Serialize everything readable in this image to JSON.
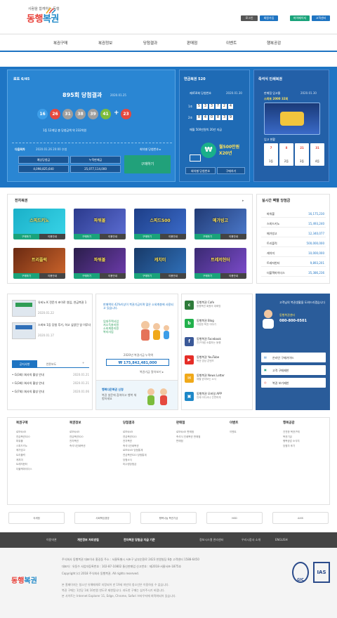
{
  "header": {
    "tagline": "사람을 함께하는 동행",
    "logo_red": "동행",
    "logo_blue": "복권",
    "buttons": [
      "로그인",
      "회원가입",
      "마이페이지",
      "고객센터"
    ]
  },
  "nav": [
    "복권구매",
    "복권정보",
    "당첨결과",
    "판매점",
    "이벤트",
    "행복공감"
  ],
  "lotto": {
    "title": "로또 6/45",
    "round": "895회 당첨결과",
    "date": "2020.01.25",
    "balls": [
      {
        "n": "16",
        "c": "#3d9ee8"
      },
      {
        "n": "26",
        "c": "#e5493e"
      },
      {
        "n": "31",
        "c": "#9e9e9e"
      },
      {
        "n": "38",
        "c": "#9e9e9e"
      },
      {
        "n": "39",
        "c": "#9e9e9e"
      },
      {
        "n": "41",
        "c": "#7cbc3c"
      },
      {
        "n": "23",
        "c": "#e5493e"
      }
    ],
    "summary": "1등 12게임 총 당첨금액 약 232억원",
    "next_label": "다음회차",
    "next_date": "2020.01.26 20:00 추첨",
    "prize_label": "예상당첨금",
    "prize_value": "4,098,825,640",
    "accum_label": "누적판매금",
    "accum_value": "25,077,114,000",
    "prev_link": "회차별 당첨번호 ▸",
    "buy": "구매하기"
  },
  "pension": {
    "title": "연금복권 520",
    "round": "제450회 당첨번호",
    "date": "2020.01.30",
    "row1_label": "1조",
    "row1": [
      "5",
      "3",
      "3",
      "7",
      "2",
      "4"
    ],
    "row2_label": "2조",
    "row2": [
      "8",
      "4",
      "0",
      "8",
      "3",
      "9"
    ],
    "bonus": "매월 500만원씩 20년 지급",
    "promo": "월500만원 X20년",
    "btn1": "회차별 당첨번호",
    "btn2": "구매하기"
  },
  "speetto": {
    "title": "즉석식 인쇄복권",
    "sub": "판매점 입고율",
    "date": "2020.01.30",
    "game": "스피또 2000 32회",
    "card_labels": [
      "1등",
      "2등",
      "3등",
      "4등"
    ],
    "stock_label": "입고 현황",
    "stock_values": [
      "7",
      "8",
      "21",
      "31"
    ]
  },
  "games": {
    "title": "전자복권",
    "list": [
      {
        "name": "스피드키노",
        "bg": "#1ab0c8",
        "a": "#37d2e6"
      },
      {
        "name": "파워볼",
        "bg": "#2b3a8c",
        "a": "#5a6bd0"
      },
      {
        "name": "스피드500",
        "bg": "#1d3e87",
        "a": "#3a6ac8"
      },
      {
        "name": "메가빙고",
        "bg": "#213a74",
        "a": "#4a77c8"
      },
      {
        "name": "트리플럭",
        "bg": "#6a2a12",
        "a": "#c8622a"
      },
      {
        "name": "파워볼",
        "bg": "#2a1e4a",
        "a": "#6a3aa8"
      },
      {
        "name": "캐치미",
        "bg": "#183a68",
        "a": "#2f6fb8"
      },
      {
        "name": "트레저헌터",
        "bg": "#3a2a72",
        "a": "#7a4ac8"
      }
    ],
    "buy": "구매하기",
    "info": "이용안내"
  },
  "ranking": {
    "title": "실시간 팩별 당첨금",
    "rows": [
      {
        "n": "파워볼",
        "v": "16,175,230"
      },
      {
        "n": "스피드키노",
        "v": "15,493,240"
      },
      {
        "n": "메가빙고",
        "v": "12,340,077"
      },
      {
        "n": "트리플럭",
        "v": "500,000,000"
      },
      {
        "n": "캐치미",
        "v": "10,000,000"
      },
      {
        "n": "트레저헌터",
        "v": "9,893,201"
      },
      {
        "n": "더블잭마이더스",
        "v": "35,386,236"
      }
    ]
  },
  "news": {
    "item1_t": "유비노 K 전문가 초이로 영입, 연금복권 1",
    "item1_d": "2020.01.22",
    "item2_t": "스피또 1등 당첨 후기, 하고 싶었던 일 이루다",
    "item2_d": "2020.01.17",
    "tabs": [
      "공지사항",
      "언론보도"
    ],
    "list": [
      {
        "t": "G(3회) 회사의 활성 안내",
        "d": "2020.01.21"
      },
      {
        "t": "G(3회) 회사의 활성 안내",
        "d": "2020.01.21"
      },
      {
        "t": "G(7회) 회사의 활성 안내",
        "d": "2020.01.06"
      }
    ]
  },
  "fund": {
    "head": "판매액의 42%이상이 복권기금이며 많은 소외계층에 사용되고 있습니다.",
    "uses": [
      "임대주택사업",
      "저소득층지원",
      "소외계층지원",
      "복지사업"
    ],
    "year_label": "2020년 복권기금 누적액",
    "amount": "₩ 175,842,481,000",
    "link": "복권기금 알아보기 ▸",
    "happy_title": "행복다운복권 신청",
    "happy_sub": "복권 설문에 참여하고 행복 체험하세요"
  },
  "sns": [
    {
      "name": "동행복권 Cafe",
      "sub": "동행복권 회원의 대화방",
      "c": "#2e7b3a",
      "i": "c"
    },
    {
      "name": "동행복권 Blog",
      "sub": "다양한 복권 이야기",
      "c": "#22b14c",
      "i": "b"
    },
    {
      "name": "동행복권 Facebook",
      "sub": "친구처럼 소통하는 동행",
      "c": "#3b5998",
      "i": "f"
    },
    {
      "name": "동행복권 YouTube",
      "sub": "복권 영상 콘텐츠",
      "c": "#e52d27",
      "i": "▶"
    },
    {
      "name": "동행복권 News Letter",
      "sub": "매월 받아보는 소식",
      "c": "#f0a91a",
      "i": "✉"
    },
    {
      "name": "동행복권 모바일 APP",
      "sub": "언제 어디서나 간편하게",
      "c": "#1e88c8",
      "i": "▣"
    }
  ],
  "support": {
    "title": "고객님의 복권생활을 도와드리겠습니다",
    "center": "동행복권센터",
    "phone": "080-800-0501",
    "btns": [
      "온라인 구매가이드",
      "고객 구매제한",
      "복권 보기제한"
    ]
  },
  "sitemap": [
    {
      "h": "복권구매",
      "i": [
        "로또6/45",
        "연금복권520",
        "파워볼",
        "스피드키노",
        "메가빙고",
        "트리플럭",
        "캐치미",
        "트레저헌터",
        "더블잭마이더스"
      ]
    },
    {
      "h": "복권정보",
      "i": [
        "로또6/45",
        "연금복권520",
        "전자복권",
        "즉석식인쇄복권"
      ]
    },
    {
      "h": "당첨결과",
      "i": [
        "로또6/45",
        "연금복권520",
        "전자복권",
        "즉석식인쇄복권",
        "로또6/45 당첨통계",
        "연금복권520 당첨통계",
        "당첨소식",
        "미수령당첨금"
      ]
    },
    {
      "h": "판매점",
      "i": [
        "로또6/45 판매점",
        "즉석식 인쇄복권 판매점",
        "판매점"
      ]
    },
    {
      "h": "이벤트",
      "i": [
        "이벤트"
      ]
    },
    {
      "h": "행복공감",
      "i": [
        "건전한 복권구매",
        "복권기금",
        "행복공감 소식지",
        "당첨자 후기"
      ]
    }
  ],
  "partners": [
    "국세청",
    "사회책임경영",
    "행복나눔 복권기금",
    "NSD",
    "AXIS"
  ],
  "footer_links": [
    "이용약관",
    "개인정보 처리방침",
    "전자복권 당첨금 지급 기준",
    "정보시스템 관리센터",
    "우리시장사 소개",
    "ENGLISH"
  ],
  "footer": {
    "addr": "주식회사 동행복권 대표이사 홍길동   주소 : 서울특별시 서초구 남부순환로 2423 한원빌딩 6층   고객센터 1588-6450",
    "reg": "대표자 : 유동수   사업자등록번호 : 102-87-10802   통신판매업 신고번호 : 제2018-서울서초-1875호",
    "copy": "Copyright (c) 2018 주식회사 동행복권. All rights reserved.",
    "note1": "본 홈페이지는 청소년 유해매체로 지정되어 만 19세 미만의 청소년은 이용하실 수 없습니다.",
    "note2": "복권 구매는 1인당 1회 10만원 한도로 제한됩니다. 과도한 구매는 삼가주시기 바랍니다.",
    "note3": "본 사이트는 Internet Explorer 11, Edge, Chrome, Safari 브라우저에 최적화되어 있습니다.",
    "badge1": "GIC",
    "badge2": "IAS"
  }
}
